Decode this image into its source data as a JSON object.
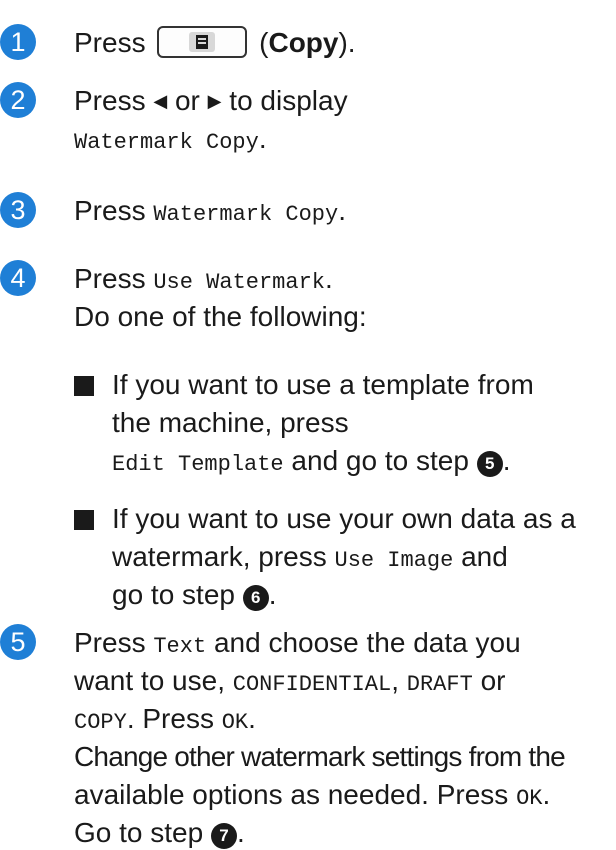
{
  "steps": [
    {
      "number": "1",
      "press": "Press",
      "copy_open": "(",
      "copy_label": "Copy",
      "copy_close": ")."
    },
    {
      "number": "2",
      "press": "Press",
      "left_arrow": "◀",
      "or": "or",
      "right_arrow": "▶",
      "to_display": "to display",
      "target": "Watermark Copy",
      "period": "."
    },
    {
      "number": "3",
      "press": "Press",
      "target": "Watermark Copy",
      "period": "."
    },
    {
      "number": "4",
      "press": "Press",
      "target": "Use Watermark",
      "period": ".",
      "instruction": "Do one of the following:",
      "bullets": [
        {
          "line1": "If you want to use a template from",
          "line2": "the machine, press",
          "button": "Edit Template",
          "after": "and go to step",
          "ref": "5",
          "end": "."
        },
        {
          "line1": "If you want to use your own data as a",
          "line2a": "watermark, press",
          "button": "Use Image",
          "line2b": "and",
          "line3": "go to step",
          "ref": "6",
          "end": "."
        }
      ]
    },
    {
      "number": "5",
      "press": "Press",
      "text_button": "Text",
      "line1_rest": "and choose the data you",
      "line2": "want to use,",
      "opt1": "CONFIDENTIAL",
      "comma": ",",
      "opt2": "DRAFT",
      "or": "or",
      "opt3": "COPY",
      "press_ok": ". Press",
      "ok": "OK",
      "period": ".",
      "line4": "Change other watermark settings from the",
      "line5": "available options as needed. Press",
      "goto": "Go to step",
      "ref": "7"
    }
  ]
}
